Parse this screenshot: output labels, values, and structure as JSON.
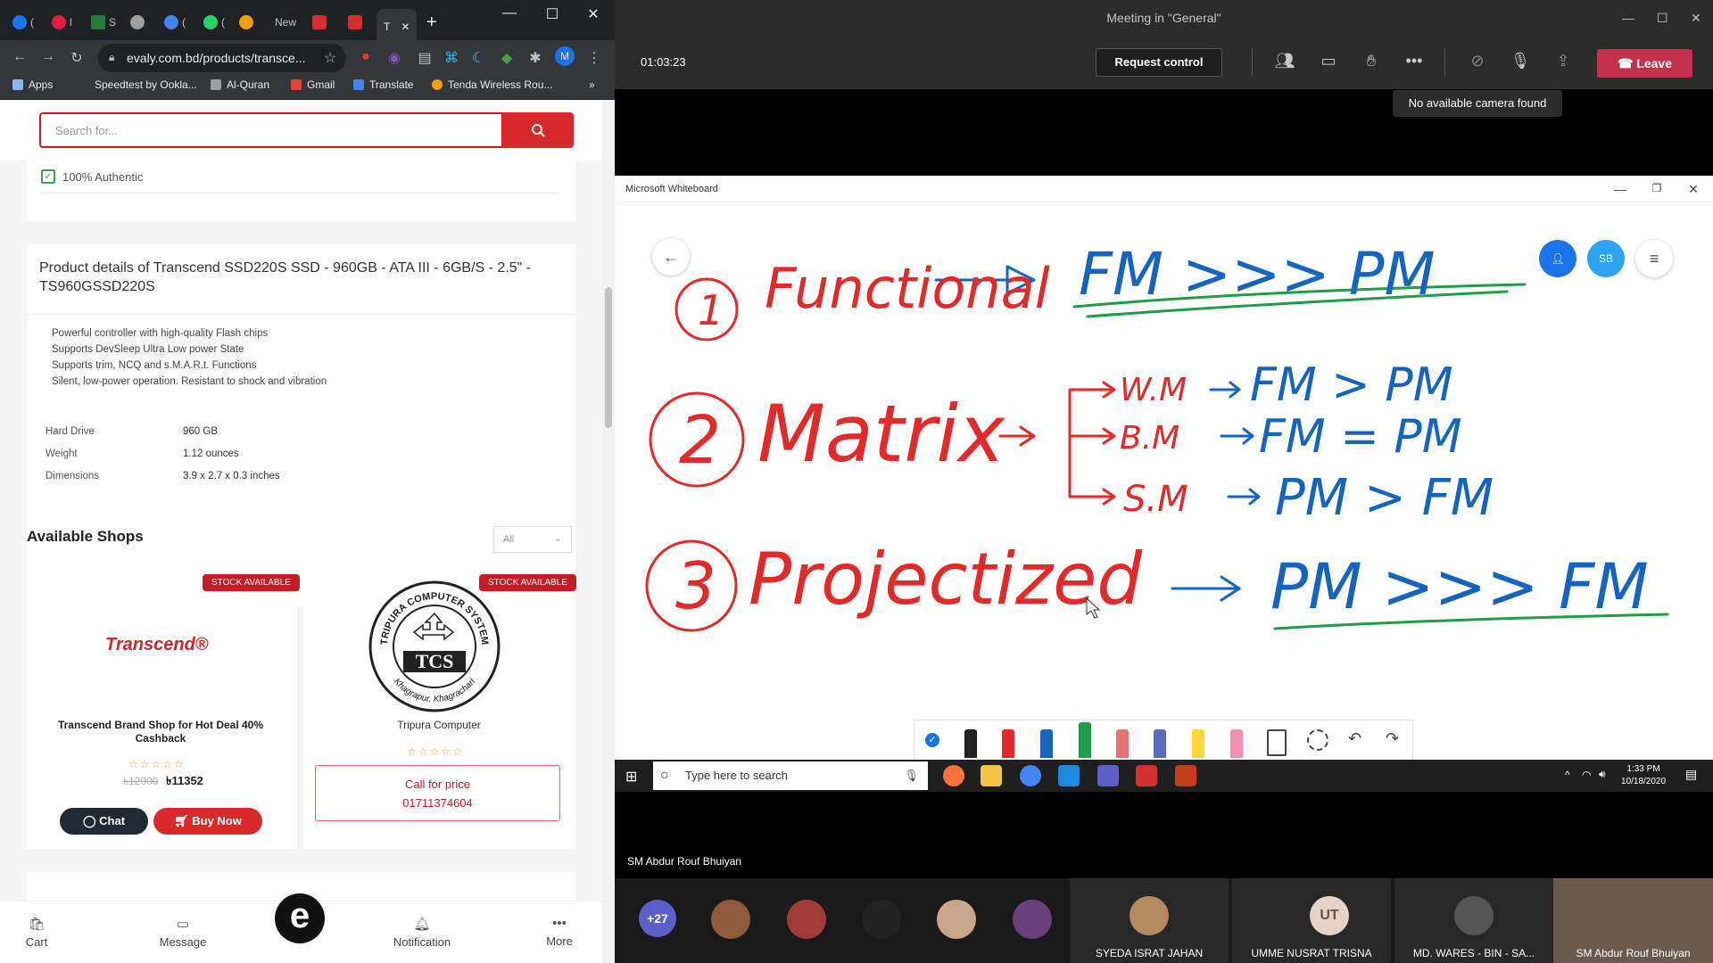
{
  "browser": {
    "tabs": [
      {
        "label": "(",
        "color": "#1877f2"
      },
      {
        "label": "l",
        "color": "#e11d48"
      },
      {
        "label": "S",
        "color": "#1e7e34"
      },
      {
        "label": "",
        "color": "#9e9e9e"
      },
      {
        "label": "(",
        "color": "#4285f4"
      },
      {
        "label": "(",
        "color": "#25d366"
      },
      {
        "label": "",
        "color": "#f59e0b"
      },
      {
        "label": "New",
        "color": "#555555"
      },
      {
        "label": "",
        "color": "#d32f2f"
      },
      {
        "label": "",
        "color": "#d32f2f"
      },
      {
        "label": "T",
        "color": "#35363a"
      }
    ],
    "url": "evaly.com.bd/products/transce...",
    "profile_initial": "M",
    "bookmarks": [
      "Apps",
      "Speedtest by Ookla...",
      "Al-Quran",
      "Gmail",
      "Translate",
      "Tenda Wireless Rou..."
    ]
  },
  "evaly": {
    "search_placeholder": "Search for...",
    "authentic": "100% Authentic",
    "product_title": "Product details of Transcend SSD220S SSD - 960GB - ATA III - 6GB/S - 2.5\" - TS960GSSD220S",
    "description": [
      "Powerful controller with high-quality Flash chips",
      "Supports DevSleep Ultra Low power State",
      "Supports trim, NCQ and s.M.A.R.t. Functions",
      "Silent, low-power operation. Resistant to shock and vibration"
    ],
    "specs": [
      {
        "label": "Hard Drive",
        "value": "960 GB"
      },
      {
        "label": "Weight",
        "value": "1.12 ounces"
      },
      {
        "label": "Dimensions",
        "value": "3.9 x 2.7 x 0.3 inches"
      }
    ],
    "shops_heading": "Available Shops",
    "shops_filter": "All",
    "shops": [
      {
        "badge": "STOCK AVAILABLE",
        "logo": "Transcend®",
        "name": "Transcend Brand Shop for Hot Deal 40% Cashback",
        "old_price": "৳12900",
        "price": "৳11352",
        "chat": "Chat",
        "buy": "Buy Now"
      },
      {
        "badge": "STOCK AVAILABLE",
        "logo": "TCS",
        "logo_ring_top": "TRIPURA COMPUTER SYSTEM",
        "logo_ring_bottom": "Khagrapur, Khagrachari",
        "name": "Tripura Computer",
        "call": "Call for price",
        "phone": "01711374604"
      }
    ],
    "nav": [
      "Cart",
      "Message",
      "Notification",
      "More"
    ],
    "logo_letter": "e"
  },
  "teams": {
    "window_title": "Meeting in \"General\"",
    "timer": "01:03:23",
    "request_control": "Request control",
    "leave": "Leave",
    "tooltip": "No available camera found",
    "whiteboard_title": "Microsoft Whiteboard",
    "wb_user_initials": "SB",
    "presenter": "SM Abdur Rouf Bhuiyan",
    "more_participants": "+27",
    "tiles": [
      {
        "name": "SYEDA ISRAT JAHAN"
      },
      {
        "name": "UMME NUSRAT TRISNA",
        "initials": "UT"
      },
      {
        "name": "MD. WARES - BIN - SA..."
      },
      {
        "name": "SM Abdur Rouf Bhuiyan"
      }
    ]
  },
  "taskbar": {
    "search_placeholder": "Type here to search",
    "time": "1:33 PM",
    "date": "10/18/2020"
  },
  "whiteboard": {
    "rows": [
      {
        "num": "1",
        "text": "Functional",
        "result": "FM >>> PM"
      },
      {
        "num": "2",
        "text": "Matrix",
        "branches": [
          {
            "label": "W.M",
            "result": "FM > PM"
          },
          {
            "label": "B.M",
            "result": "FM = PM"
          },
          {
            "label": "S.M",
            "result": "PM > FM"
          }
        ]
      },
      {
        "num": "3",
        "text": "Projectized",
        "result": "PM >>> FM"
      }
    ]
  },
  "colors": {
    "evaly_red": "#c51d27",
    "teams_leave": "#c4314b",
    "ink_red": "#e22a2a",
    "ink_blue": "#1565c0",
    "ink_green": "#1f9e4a"
  }
}
